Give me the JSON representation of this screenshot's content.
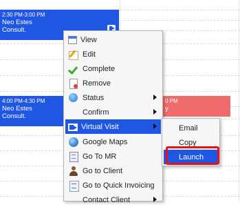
{
  "calendar": {
    "appointments": [
      {
        "time": "2:30 PM-3:00 PM",
        "name": "Neo Estes",
        "type": "Consult.",
        "color": "#1f57e4"
      },
      {
        "time": "4:00 PM-4:30 PM",
        "name": "Neo Estes",
        "type": "Consult.",
        "color": "#1f57e4"
      },
      {
        "time_fragment": "0 PM",
        "name_fragment": "y",
        "color": "#ef6b6b"
      }
    ]
  },
  "context_menu": {
    "items": [
      {
        "label": "View",
        "icon": "calendar-view-icon"
      },
      {
        "label": "Edit",
        "icon": "edit-pencil-icon"
      },
      {
        "label": "Complete",
        "icon": "checkmark-icon"
      },
      {
        "label": "Remove",
        "icon": "remove-document-icon"
      },
      {
        "label": "Status",
        "icon": "status-globe-icon",
        "has_submenu": true
      },
      {
        "label": "Confirm",
        "has_submenu": true
      },
      {
        "label": "Virtual Visit",
        "icon": "video-camera-icon",
        "has_submenu": true,
        "highlighted": true
      },
      {
        "label": "Google Maps",
        "icon": "globe-map-icon"
      },
      {
        "label": "Go To MR",
        "icon": "medical-record-icon"
      },
      {
        "label": "Go to Client",
        "icon": "person-icon"
      },
      {
        "label": "Go to Quick Invoicing",
        "icon": "invoice-icon"
      },
      {
        "label": "Contact Client",
        "has_submenu": true
      }
    ]
  },
  "submenu": {
    "items": [
      {
        "label": "Email"
      },
      {
        "label": "Copy"
      },
      {
        "label": "Launch",
        "highlighted": true
      }
    ],
    "callout_color": "#e3131c"
  },
  "colors": {
    "accent": "#1f57e4",
    "highlight_text": "#ffffff",
    "menu_bg": "#f6f6f6"
  }
}
